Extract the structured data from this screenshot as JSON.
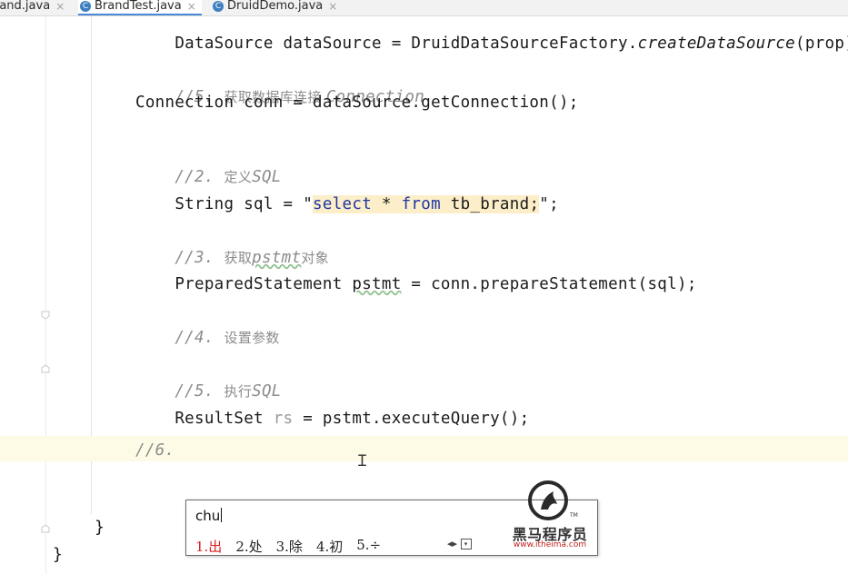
{
  "tabs": [
    {
      "label": "rand.java",
      "close": "×",
      "active": false
    },
    {
      "label": "BrandTest.java",
      "close": "×",
      "active": true,
      "icon": "C"
    },
    {
      "label": "DruidDemo.java",
      "close": "×",
      "active": false,
      "icon": "C"
    }
  ],
  "code": {
    "l0": {
      "a": "DataSource dataSource = DruidDataSourceFactory.",
      "b": "createDataSource",
      "c": "(prop)"
    },
    "l1": {
      "slash": "//5. ",
      "cn": "获取数据库连接 ",
      "en": "Connection"
    },
    "l2": "Connection conn = dataSource.getConnection();",
    "l3": {
      "slash": "//2. ",
      "cn": "定义",
      "en": "SQL"
    },
    "l4": {
      "a": "String sql = \"",
      "k1": "select",
      "m": " * ",
      "k2": "from",
      "s": " tb_brand;",
      "q": "\"",
      "e": ";"
    },
    "l5": {
      "slash": "//3. ",
      "cn1": "获取",
      "en": "pstmt",
      "cn2": "对象"
    },
    "l6": {
      "a": "PreparedStatement ",
      "w": "pstmt",
      "b": " = conn.prepareStatement(sql);"
    },
    "l7": {
      "slash": "//4. ",
      "cn": "设置参数"
    },
    "l8": {
      "slash": "//5. ",
      "cn": "执行",
      "en": "SQL"
    },
    "l9": {
      "a": "ResultSet ",
      "d": "rs",
      "b": " = pstmt.executeQuery();"
    },
    "l10": "//6.",
    "brace1": "}",
    "brace2": "}"
  },
  "ime": {
    "input": "chu",
    "candidates": [
      "1.出",
      "2.处",
      "3.除",
      "4.初",
      "5.÷"
    ],
    "nav": "◂▸",
    "logo_text": "黑马程序员",
    "logo_url": "www.itheima.com",
    "tm": "TM"
  },
  "colors": {
    "keyword": "#1f35a8",
    "comment": "#8c8c8c",
    "string_bg": "#fbeec8",
    "current_line": "#fdfbe6",
    "selected_candidate": "#d62020"
  }
}
